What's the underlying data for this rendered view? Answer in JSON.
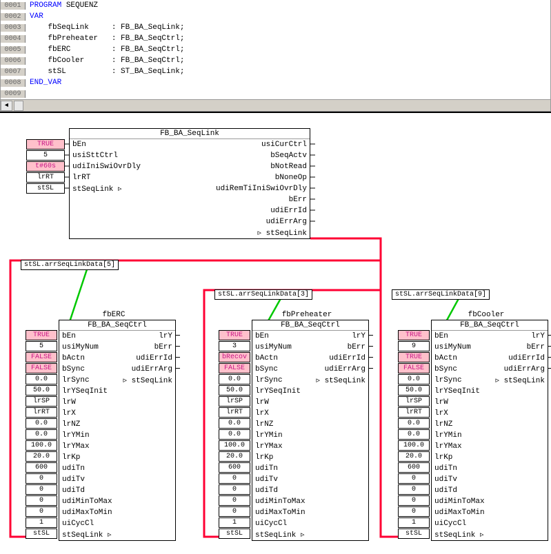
{
  "code": {
    "lines": [
      {
        "num": "0001",
        "pre": "",
        "kw": "PROGRAM",
        "rest": " SEQUENZ"
      },
      {
        "num": "0002",
        "pre": "",
        "kw": "VAR",
        "rest": ""
      },
      {
        "num": "0003",
        "pre": "    ",
        "kw": "",
        "rest": "fbSeqLink     : FB_BA_SeqLink;"
      },
      {
        "num": "0004",
        "pre": "    ",
        "kw": "",
        "rest": "fbPreheater   : FB_BA_SeqCtrl;"
      },
      {
        "num": "0005",
        "pre": "    ",
        "kw": "",
        "rest": "fbERC         : FB_BA_SeqCtrl;"
      },
      {
        "num": "0006",
        "pre": "    ",
        "kw": "",
        "rest": "fbCooler      : FB_BA_SeqCtrl;"
      },
      {
        "num": "0007",
        "pre": "    ",
        "kw": "",
        "rest": "stSL          : ST_BA_SeqLink;"
      },
      {
        "num": "0008",
        "pre": "",
        "kw": "END_VAR",
        "rest": ""
      },
      {
        "num": "0009",
        "pre": "",
        "kw": "",
        "rest": ""
      }
    ]
  },
  "mainBlock": {
    "instance": "",
    "type": "FB_BA_SeqLink",
    "inputs": [
      "bEn",
      "usiSttCtrl",
      "udiIniSwiOvrDly",
      "lrRT",
      "stSeqLink ▹"
    ],
    "outputs": [
      "usiCurCtrl",
      "bSeqActv",
      "bNotRead",
      "bNoneOp",
      "udiRemTiIniSwiOvrDly",
      "bErr",
      "udiErrId",
      "udiErrArg",
      "▹ stSeqLink"
    ],
    "ports": [
      {
        "val": "TRUE",
        "pink": true
      },
      {
        "val": "5",
        "pink": false
      },
      {
        "val": "t#60s",
        "pink": true
      },
      {
        "val": "lrRT",
        "pink": false
      },
      {
        "val": "stSL",
        "pink": false
      }
    ]
  },
  "branches": [
    {
      "label": "stSL.arrSeqLinkData[5]"
    },
    {
      "label": "stSL.arrSeqLinkData[3]"
    },
    {
      "label": "stSL.arrSeqLinkData[9]"
    }
  ],
  "ctrls": [
    {
      "instance": "fbERC",
      "type": "FB_BA_SeqCtrl",
      "ports": [
        {
          "v": "TRUE",
          "p": true
        },
        {
          "v": "5",
          "p": false
        },
        {
          "v": "FALSE",
          "p": true
        },
        {
          "v": "FALSE",
          "p": true
        },
        {
          "v": "0.0",
          "p": false
        },
        {
          "v": "50.0",
          "p": false
        },
        {
          "v": "lrSP",
          "p": false
        },
        {
          "v": "lrRT",
          "p": false
        },
        {
          "v": "0.0",
          "p": false
        },
        {
          "v": "0.0",
          "p": false
        },
        {
          "v": "100.0",
          "p": false
        },
        {
          "v": "20.0",
          "p": false
        },
        {
          "v": "600",
          "p": false
        },
        {
          "v": "0",
          "p": false
        },
        {
          "v": "0",
          "p": false
        },
        {
          "v": "0",
          "p": false
        },
        {
          "v": "0",
          "p": false
        },
        {
          "v": "1",
          "p": false
        },
        {
          "v": "stSL",
          "p": false
        }
      ]
    },
    {
      "instance": "fbPreheater",
      "type": "FB_BA_SeqCtrl",
      "ports": [
        {
          "v": "TRUE",
          "p": true
        },
        {
          "v": "3",
          "p": false
        },
        {
          "v": "bRecov",
          "p": true
        },
        {
          "v": "FALSE",
          "p": true
        },
        {
          "v": "0.0",
          "p": false
        },
        {
          "v": "50.0",
          "p": false
        },
        {
          "v": "lrSP",
          "p": false
        },
        {
          "v": "lrRT",
          "p": false
        },
        {
          "v": "0.0",
          "p": false
        },
        {
          "v": "0.0",
          "p": false
        },
        {
          "v": "100.0",
          "p": false
        },
        {
          "v": "20.0",
          "p": false
        },
        {
          "v": "600",
          "p": false
        },
        {
          "v": "0",
          "p": false
        },
        {
          "v": "0",
          "p": false
        },
        {
          "v": "0",
          "p": false
        },
        {
          "v": "0",
          "p": false
        },
        {
          "v": "1",
          "p": false
        },
        {
          "v": "stSL",
          "p": false
        }
      ]
    },
    {
      "instance": "fbCooler",
      "type": "FB_BA_SeqCtrl",
      "ports": [
        {
          "v": "TRUE",
          "p": true
        },
        {
          "v": "9",
          "p": false
        },
        {
          "v": "TRUE",
          "p": true
        },
        {
          "v": "FALSE",
          "p": true
        },
        {
          "v": "0.0",
          "p": false
        },
        {
          "v": "50.0",
          "p": false
        },
        {
          "v": "lrSP",
          "p": false
        },
        {
          "v": "lrRT",
          "p": false
        },
        {
          "v": "0.0",
          "p": false
        },
        {
          "v": "0.0",
          "p": false
        },
        {
          "v": "100.0",
          "p": false
        },
        {
          "v": "20.0",
          "p": false
        },
        {
          "v": "600",
          "p": false
        },
        {
          "v": "0",
          "p": false
        },
        {
          "v": "0",
          "p": false
        },
        {
          "v": "0",
          "p": false
        },
        {
          "v": "0",
          "p": false
        },
        {
          "v": "1",
          "p": false
        },
        {
          "v": "stSL",
          "p": false
        }
      ]
    }
  ],
  "ctrlInputs": [
    "bEn",
    "usiMyNum",
    "bActn",
    "bSync",
    "lrSync",
    "lrYSeqInit",
    "lrW",
    "lrX",
    "lrNZ",
    "lrYMin",
    "lrYMax",
    "lrKp",
    "udiTn",
    "udiTv",
    "udiTd",
    "udiMinToMax",
    "udiMaxToMin",
    "uiCycCl",
    "stSeqLink ▹"
  ],
  "ctrlOutputs": [
    "lrY",
    "bErr",
    "udiErrId",
    "udiErrArg",
    "▹ stSeqLink"
  ]
}
